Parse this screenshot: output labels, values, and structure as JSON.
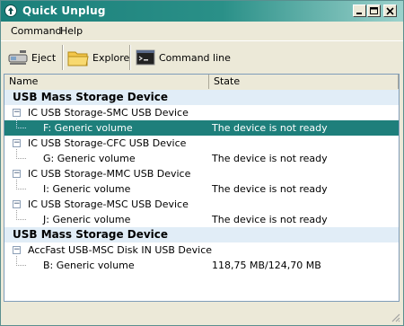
{
  "window": {
    "title": "Quick Unplug",
    "controls": [
      "minimize",
      "maximize",
      "close"
    ]
  },
  "menu": {
    "items": [
      "Command",
      "Help"
    ]
  },
  "toolbar": {
    "eject_label": "Eject",
    "explore_label": "Explore",
    "cmdline_label": "Command line"
  },
  "list": {
    "columns": [
      "Name",
      "State"
    ],
    "groups": [
      {
        "title": "USB Mass Storage Device",
        "devices": [
          {
            "name": "IC USB Storage-SMC USB Device",
            "volume": "F: Generic volume",
            "state": "The device is not ready",
            "selected": true
          },
          {
            "name": "IC USB Storage-CFC USB Device",
            "volume": "G: Generic volume",
            "state": "The device is not ready"
          },
          {
            "name": "IC USB Storage-MMC USB Device",
            "volume": "I: Generic volume",
            "state": "The device is not ready"
          },
          {
            "name": "IC USB Storage-MSC USB Device",
            "volume": "J: Generic volume",
            "state": "The device is not ready"
          }
        ]
      },
      {
        "title": "USB Mass Storage Device",
        "devices": [
          {
            "name": "AccFast  USB-MSC Disk IN USB Device",
            "volume": "B: Generic volume",
            "state": "118,75 MB/124,70 MB"
          }
        ]
      }
    ]
  },
  "colors": {
    "titlebar": "#1b7f7a",
    "selection": "#1e7f7b",
    "group_bg": "#e1edf7"
  }
}
